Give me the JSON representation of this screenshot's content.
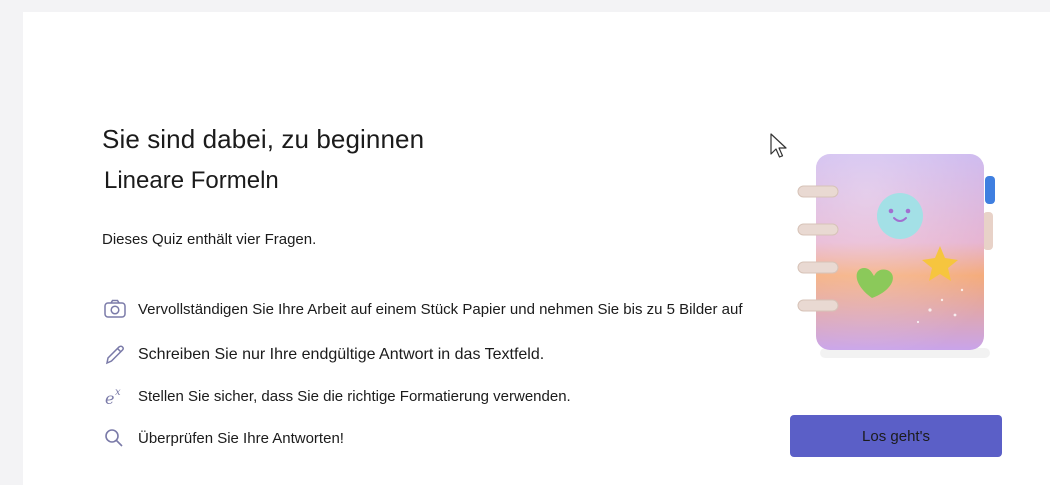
{
  "header": {
    "title": "Sie sind dabei, zu beginnen",
    "quiz_name": "Lineare Formeln"
  },
  "description": "Dieses Quiz enthält vier Fragen.",
  "instructions": [
    {
      "icon": "camera-icon",
      "text": "Vervollständigen Sie Ihre Arbeit auf einem Stück Papier und nehmen Sie bis zu 5 Bilder auf"
    },
    {
      "icon": "pencil-icon",
      "text": "Schreiben Sie nur Ihre endgültige Antwort in das Textfeld."
    },
    {
      "icon": "exponent-icon",
      "text": "Stellen Sie sicher, dass Sie die richtige Formatierung verwenden."
    },
    {
      "icon": "search-icon",
      "text": "Überprüfen Sie Ihre Antworten!"
    }
  ],
  "actions": {
    "start_label": "Los geht's"
  },
  "colors": {
    "accent": "#5b5fc7",
    "icon": "#7a7aa8",
    "background": "#f3f3f5",
    "card": "#ffffff"
  }
}
